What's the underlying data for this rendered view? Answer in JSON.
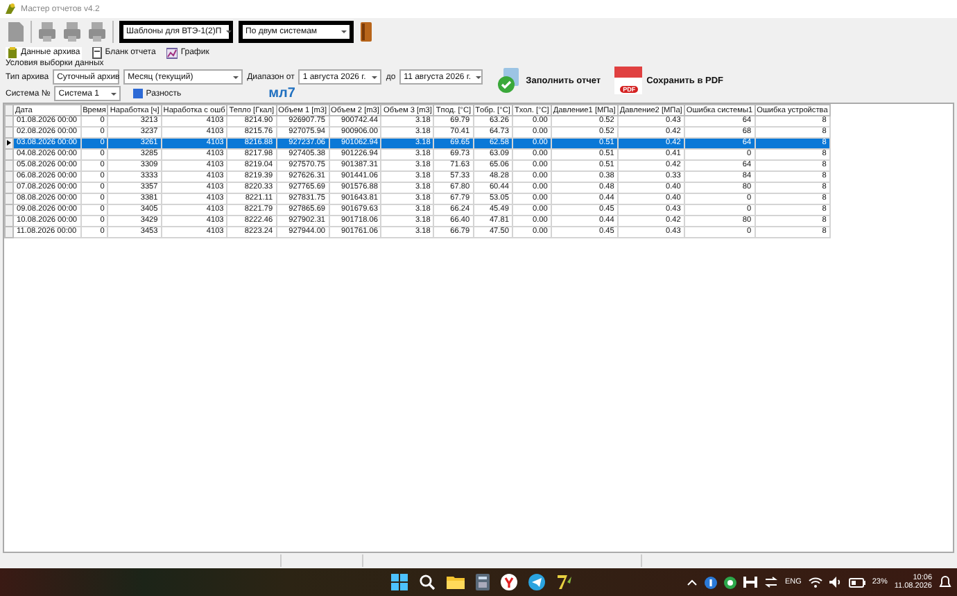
{
  "window": {
    "title": "Мастер отчетов v4.2"
  },
  "toolbar": {
    "template": "Шаблоны для ВТЭ-1(2)П",
    "mode": "По двум системам"
  },
  "tabs": [
    {
      "label": "Данные архива",
      "selected": true
    },
    {
      "label": "Бланк отчета",
      "selected": false
    },
    {
      "label": "График",
      "selected": false
    }
  ],
  "conditions": {
    "title": "Условия выборки данных",
    "archive_label": "Тип архива",
    "archive": "Суточный архив",
    "period": "Месяц (текущий)",
    "range_label": "Диапазон от",
    "from": "1  августа  2026 г.",
    "to_label": "до",
    "to": "11  августа  2026 г.",
    "system_label": "Система №",
    "system": "Система 1",
    "difference": {
      "label": "Разность",
      "checked": true
    },
    "device": "мл7",
    "fill_button": "Заполнить отчет",
    "pdf_button": "Сохранить в PDF",
    "pdf_badge": "PDF"
  },
  "table": {
    "columns": [
      "Дата",
      "Время",
      "Наработка [ч]",
      "Наработка с ошб",
      "Тепло [Гкал]",
      "Объем 1 [m3]",
      "Объем 2 [m3]",
      "Объем 3 [m3]",
      "Tпод. [°C]",
      "Tобр. [°C]",
      "Tхол. [°C]",
      "Давление1 [MПa]",
      "Давление2 [MПa]",
      "Ошибка системы1",
      "Ошибка устройства"
    ],
    "rows": [
      {
        "selected": false,
        "cells": [
          "01.08.2026 00:00",
          "0",
          "3213",
          "4103",
          "8214.90",
          "926907.75",
          "900742.44",
          "3.18",
          "69.79",
          "63.26",
          "0.00",
          "0.52",
          "0.43",
          "64",
          "8"
        ]
      },
      {
        "selected": false,
        "cells": [
          "02.08.2026 00:00",
          "0",
          "3237",
          "4103",
          "8215.76",
          "927075.94",
          "900906.00",
          "3.18",
          "70.41",
          "64.73",
          "0.00",
          "0.52",
          "0.42",
          "68",
          "8"
        ]
      },
      {
        "selected": true,
        "cells": [
          "03.08.2026 00:00",
          "0",
          "3261",
          "4103",
          "8216.88",
          "927237.06",
          "901062.94",
          "3.18",
          "69.65",
          "62.58",
          "0.00",
          "0.51",
          "0.42",
          "64",
          "8"
        ]
      },
      {
        "selected": false,
        "cells": [
          "04.08.2026 00:00",
          "0",
          "3285",
          "4103",
          "8217.98",
          "927405.38",
          "901226.94",
          "3.18",
          "69.73",
          "63.09",
          "0.00",
          "0.51",
          "0.41",
          "0",
          "8"
        ]
      },
      {
        "selected": false,
        "cells": [
          "05.08.2026 00:00",
          "0",
          "3309",
          "4103",
          "8219.04",
          "927570.75",
          "901387.31",
          "3.18",
          "71.63",
          "65.06",
          "0.00",
          "0.51",
          "0.42",
          "64",
          "8"
        ]
      },
      {
        "selected": false,
        "cells": [
          "06.08.2026 00:00",
          "0",
          "3333",
          "4103",
          "8219.39",
          "927626.31",
          "901441.06",
          "3.18",
          "57.33",
          "48.28",
          "0.00",
          "0.38",
          "0.33",
          "84",
          "8"
        ]
      },
      {
        "selected": false,
        "cells": [
          "07.08.2026 00:00",
          "0",
          "3357",
          "4103",
          "8220.33",
          "927765.69",
          "901576.88",
          "3.18",
          "67.80",
          "60.44",
          "0.00",
          "0.48",
          "0.40",
          "80",
          "8"
        ]
      },
      {
        "selected": false,
        "cells": [
          "08.08.2026 00:00",
          "0",
          "3381",
          "4103",
          "8221.11",
          "927831.75",
          "901643.81",
          "3.18",
          "67.79",
          "53.05",
          "0.00",
          "0.44",
          "0.40",
          "0",
          "8"
        ]
      },
      {
        "selected": false,
        "cells": [
          "09.08.2026 00:00",
          "0",
          "3405",
          "4103",
          "8221.79",
          "927865.69",
          "901679.63",
          "3.18",
          "66.24",
          "45.49",
          "0.00",
          "0.45",
          "0.43",
          "0",
          "8"
        ]
      },
      {
        "selected": false,
        "cells": [
          "10.08.2026 00:00",
          "0",
          "3429",
          "4103",
          "8222.46",
          "927902.31",
          "901718.06",
          "3.18",
          "66.40",
          "47.81",
          "0.00",
          "0.44",
          "0.42",
          "80",
          "8"
        ]
      },
      {
        "selected": false,
        "cells": [
          "11.08.2026 00:00",
          "0",
          "3453",
          "4103",
          "8223.24",
          "927944.00",
          "901761.06",
          "3.18",
          "66.79",
          "47.50",
          "0.00",
          "0.45",
          "0.43",
          "0",
          "8"
        ]
      }
    ]
  },
  "taskbar": {
    "language": "ENG",
    "battery": "23%",
    "time": "10:06",
    "date": "11.08.2026"
  }
}
